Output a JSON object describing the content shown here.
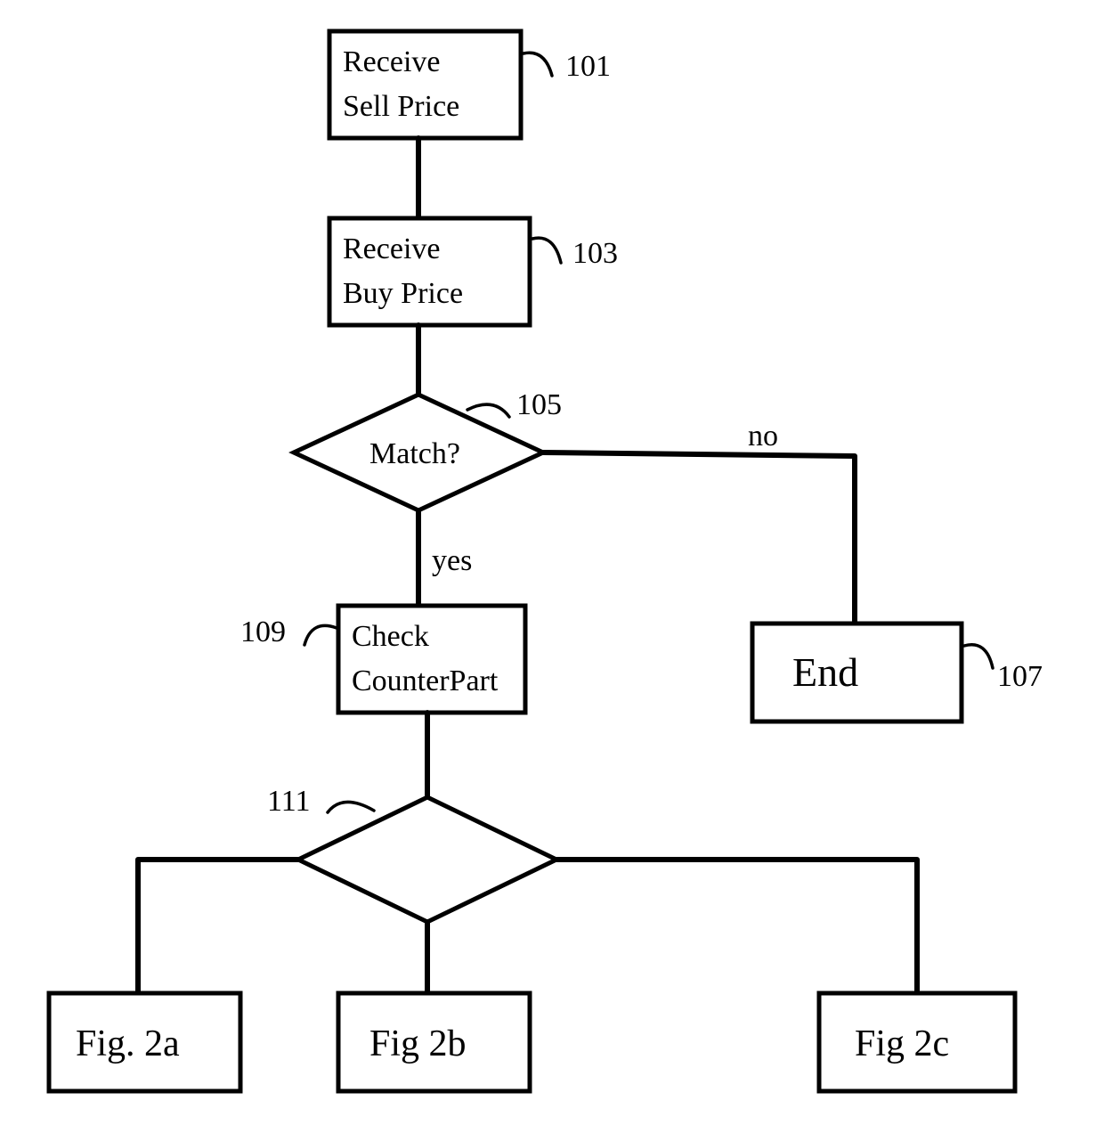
{
  "nodes": {
    "n101": {
      "line1": "Receive",
      "line2": "Sell Price"
    },
    "n103": {
      "line1": "Receive",
      "line2": "Buy Price"
    },
    "n105": {
      "text": "Match?"
    },
    "n107": {
      "text": "End"
    },
    "n109": {
      "line1": "Check",
      "line2": "CounterPart"
    },
    "fig2a": {
      "text": "Fig. 2a"
    },
    "fig2b": {
      "text": "Fig 2b"
    },
    "fig2c": {
      "text": "Fig 2c"
    }
  },
  "labels": {
    "ref101": "101",
    "ref103": "103",
    "ref105": "105",
    "ref107": "107",
    "ref109": "109",
    "ref111": "111",
    "yes": "yes",
    "no": "no"
  }
}
